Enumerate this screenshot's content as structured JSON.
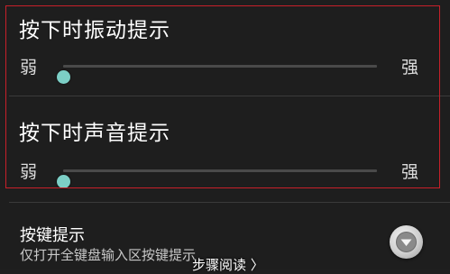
{
  "settings": {
    "vibration": {
      "title": "按下时振动提示",
      "min_label": "弱",
      "max_label": "强",
      "level": 0.0
    },
    "sound": {
      "title": "按下时声音提示",
      "min_label": "弱",
      "max_label": "强",
      "level": 0.0
    },
    "key_hint": {
      "title": "按键提示",
      "description": "仅打开全键盘输入区按键提示",
      "control_icon": "chevron-down-circle-icon"
    }
  },
  "overlay": {
    "caption": "步骤阅读 〉"
  },
  "colors": {
    "highlight_border": "#c8202a",
    "slider_accent": "#7ccfc6",
    "background": "#1e1e1e"
  }
}
